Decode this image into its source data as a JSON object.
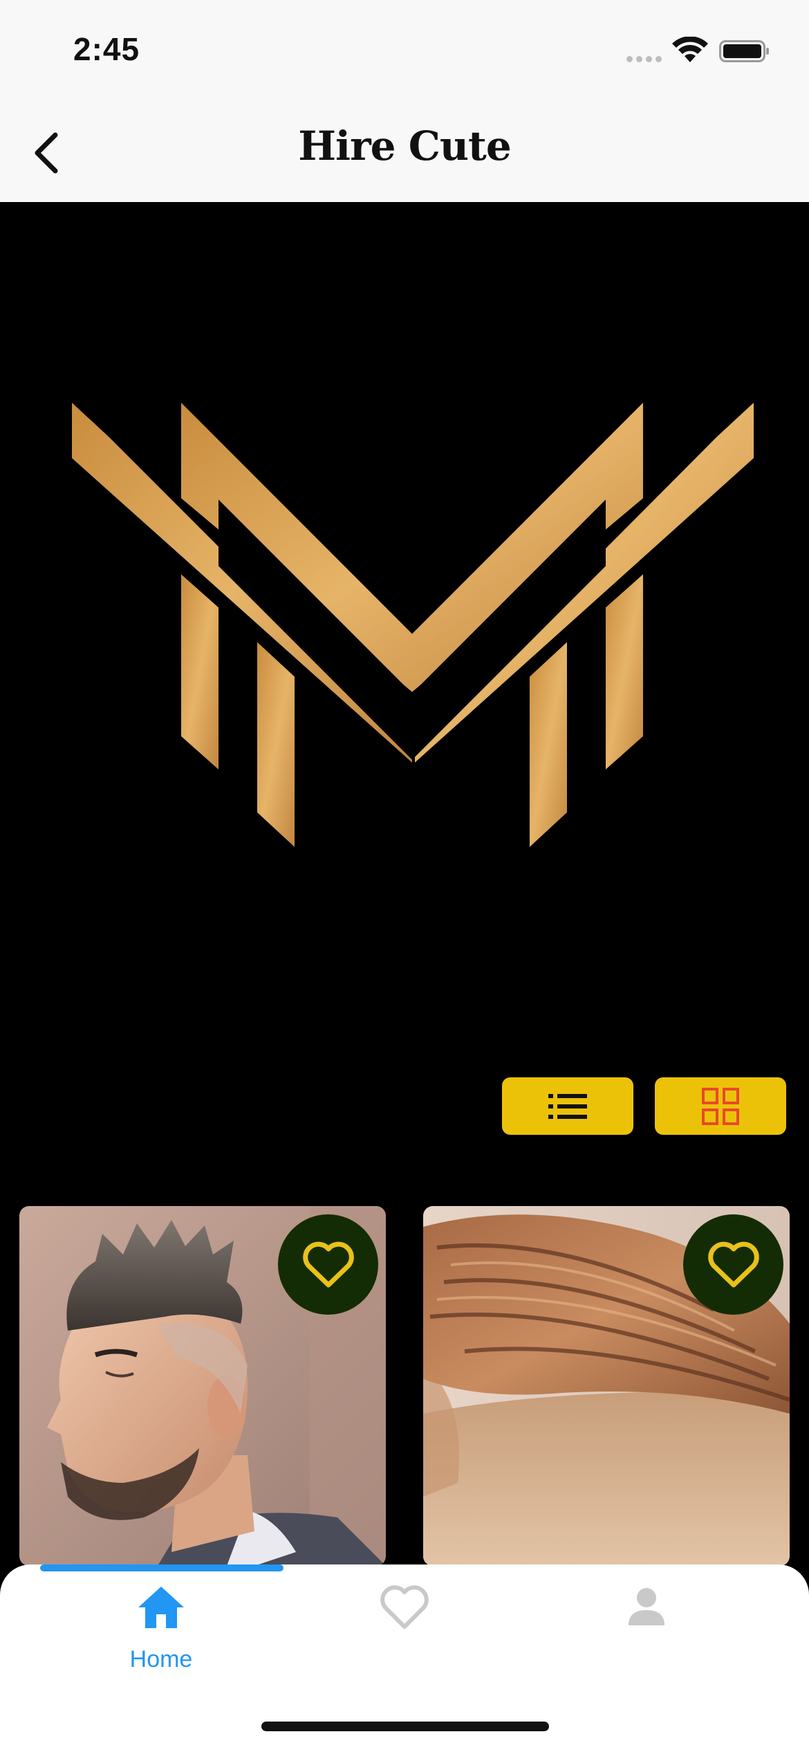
{
  "status_bar": {
    "time": "2:45"
  },
  "header": {
    "back_icon": "chevron-left-icon",
    "title": "Hire Cute"
  },
  "banner": {
    "logo": "gold-monogram-logo"
  },
  "view_toggles": [
    {
      "name": "list-view",
      "icon": "list-icon",
      "color": "#ecc209"
    },
    {
      "name": "grid-view",
      "icon": "grid-icon",
      "color": "#ecc209"
    }
  ],
  "cards": [
    {
      "image": "textured-spiky-fade-haircut-photo",
      "favorite_icon": "heart-outline-icon"
    },
    {
      "image": "side-swept-undercut-haircut-photo",
      "favorite_icon": "heart-outline-icon"
    }
  ],
  "tab_bar": {
    "tabs": [
      {
        "icon": "home-icon",
        "label": "Home",
        "active": true
      },
      {
        "icon": "heart-icon",
        "label": "",
        "active": false
      },
      {
        "icon": "person-icon",
        "label": "",
        "active": false
      }
    ]
  },
  "colors": {
    "accent": "#2196f3",
    "toggle_yellow": "#ecc209",
    "grid_icon_red": "#e8492b",
    "logo_gold": "#dba95a",
    "fav_button_bg": "#142c05",
    "heart_yellow": "#e8c21a"
  }
}
